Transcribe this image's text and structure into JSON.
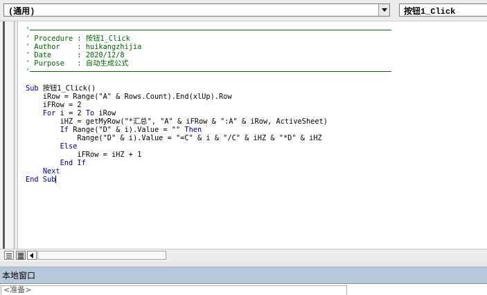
{
  "toolbar": {
    "object_dropdown": "(通用)",
    "procedure_dropdown": "按钮1_Click"
  },
  "code_lines": [
    {
      "text": "'",
      "kind": "rule"
    },
    {
      "text": "' Procedure : 按钮1_Click",
      "kind": "comment"
    },
    {
      "text": "' Author    : huikangzhijia",
      "kind": "comment"
    },
    {
      "text": "' Date      : 2020/12/8",
      "kind": "comment"
    },
    {
      "text": "' Purpose   : 自动生成公式",
      "kind": "comment"
    },
    {
      "text": "'",
      "kind": "rule"
    },
    {
      "text": "",
      "kind": "blank"
    },
    {
      "text": "Sub 按钮1_Click()",
      "kind": "code"
    },
    {
      "text": "    iRow = Range(\"A\" & Rows.Count).End(xlUp).Row",
      "kind": "code"
    },
    {
      "text": "    iFRow = 2",
      "kind": "code"
    },
    {
      "text": "    For i = 2 To iRow",
      "kind": "code"
    },
    {
      "text": "        iHZ = getMyRow(\"*汇总\", \"A\" & iFRow & \":A\" & iRow, ActiveSheet)",
      "kind": "code"
    },
    {
      "text": "        If Range(\"D\" & i).Value = \"\" Then",
      "kind": "code"
    },
    {
      "text": "            Range(\"D\" & i).Value = \"=C\" & i & \"/C\" & iHZ & \"*D\" & iHZ",
      "kind": "code"
    },
    {
      "text": "        Else",
      "kind": "code"
    },
    {
      "text": "            iFRow = iHZ + 1",
      "kind": "code"
    },
    {
      "text": "        End If",
      "kind": "code"
    },
    {
      "text": "    Next",
      "kind": "code"
    },
    {
      "text": "End Sub",
      "kind": "code_caret"
    }
  ],
  "locals_window": {
    "title": "本地窗口",
    "status_text": "<准备>"
  },
  "colors": {
    "comment": "#006400",
    "keyword": "#00008b",
    "title_bar": "#b7c9dc"
  },
  "icons": {
    "dropdown_arrow": "chevron-down-icon",
    "procedure_view": "procedure-view-icon",
    "full_module_view": "full-module-view-icon",
    "scroll_left": "arrow-left-icon"
  }
}
